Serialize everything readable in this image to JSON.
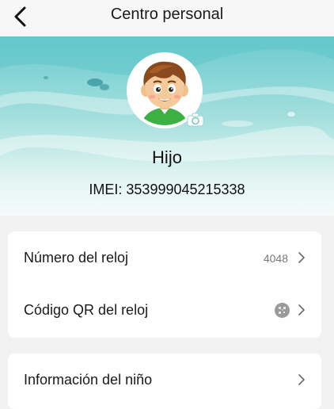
{
  "header": {
    "title": "Centro personal",
    "back_icon": "chevron-left-icon"
  },
  "profile": {
    "name": "Hijo",
    "imei": "IMEI: 353999045215338",
    "avatar": "boy-avatar",
    "camera_icon": "camera-icon"
  },
  "settings": {
    "rows": [
      {
        "label": "Número del reloj",
        "value": "4048",
        "icon": "chevron-right-icon"
      },
      {
        "label": "Código QR del reloj",
        "value_icon": "qr-code-icon",
        "icon": "chevron-right-icon"
      }
    ]
  },
  "child_section": {
    "rows": [
      {
        "label": "Información del niño",
        "icon": "chevron-right-icon"
      }
    ]
  },
  "colors": {
    "banner_teal": "#7fd0d2",
    "page_bg": "#f2f2f2",
    "card_bg": "#ffffff",
    "value_gray": "#777777"
  }
}
